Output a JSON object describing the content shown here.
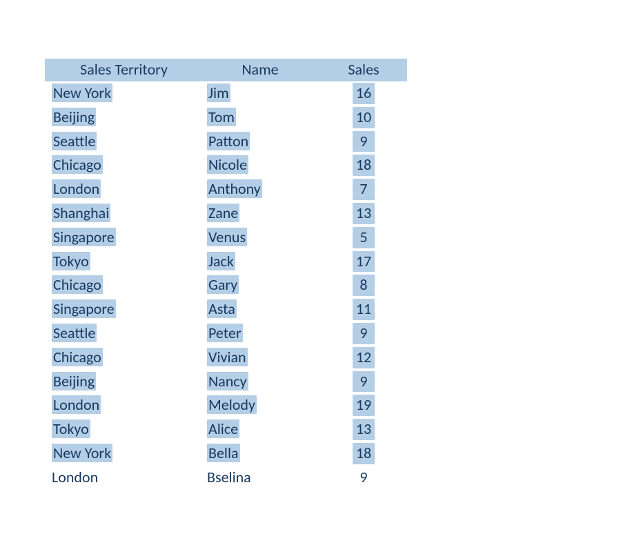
{
  "chart_data": {
    "type": "table",
    "columns": [
      "Sales Territory",
      "Name",
      "Sales"
    ],
    "rows": [
      {
        "territory": "New York",
        "name": "Jim",
        "sales": 16,
        "hl": [
          true,
          true,
          true
        ]
      },
      {
        "territory": "Beijing",
        "name": "Tom",
        "sales": 10,
        "hl": [
          true,
          true,
          true
        ]
      },
      {
        "territory": "Seattle",
        "name": "Patton",
        "sales": 9,
        "hl": [
          true,
          true,
          true
        ]
      },
      {
        "territory": "Chicago",
        "name": "Nicole",
        "sales": 18,
        "hl": [
          true,
          true,
          true
        ]
      },
      {
        "territory": "London",
        "name": "Anthony",
        "sales": 7,
        "hl": [
          true,
          true,
          true
        ]
      },
      {
        "territory": "Shanghai",
        "name": "Zane",
        "sales": 13,
        "hl": [
          true,
          true,
          true
        ]
      },
      {
        "territory": "Singapore",
        "name": "Venus",
        "sales": 5,
        "hl": [
          true,
          true,
          true
        ]
      },
      {
        "territory": "Tokyo",
        "name": "Jack",
        "sales": 17,
        "hl": [
          true,
          true,
          true
        ]
      },
      {
        "territory": "Chicago",
        "name": "Gary",
        "sales": 8,
        "hl": [
          true,
          true,
          true
        ]
      },
      {
        "territory": "Singapore",
        "name": "Asta",
        "sales": 11,
        "hl": [
          true,
          true,
          true
        ]
      },
      {
        "territory": "Seattle",
        "name": "Peter",
        "sales": 9,
        "hl": [
          true,
          true,
          true
        ]
      },
      {
        "territory": "Chicago",
        "name": "Vivian",
        "sales": 12,
        "hl": [
          true,
          true,
          true
        ]
      },
      {
        "territory": "Beijing",
        "name": "Nancy",
        "sales": 9,
        "hl": [
          true,
          true,
          true
        ]
      },
      {
        "territory": "London",
        "name": "Melody",
        "sales": 19,
        "hl": [
          true,
          true,
          true
        ]
      },
      {
        "territory": "Tokyo",
        "name": "Alice",
        "sales": 13,
        "hl": [
          true,
          true,
          true
        ]
      },
      {
        "territory": "New York",
        "name": "Bella",
        "sales": 18,
        "hl": [
          true,
          true,
          true
        ]
      },
      {
        "territory": "London",
        "name": "Bselina",
        "sales": 9,
        "hl": [
          false,
          false,
          false
        ]
      }
    ]
  }
}
